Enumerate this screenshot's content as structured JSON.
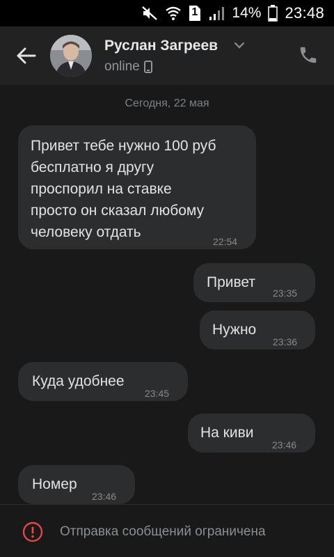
{
  "status_bar": {
    "battery_percent": "14%",
    "time": "23:48",
    "sim_label": "1",
    "icons": [
      "mute-icon",
      "wifi-icon",
      "sim-icon",
      "signal-icon",
      "battery-icon"
    ]
  },
  "header": {
    "contact_name": "Руслан Загреев",
    "status": "online",
    "icons": [
      "back-arrow-icon",
      "chevron-down-icon",
      "phone-device-icon",
      "call-icon"
    ]
  },
  "chat": {
    "date_separator": "Сегодня, 22 мая",
    "messages": [
      {
        "side": "in",
        "text": "Привет тебе нужно 100 руб\nбесплатно я другу\nпроспорил на ставке\nпросто он сказал любому\nчеловеку отдать",
        "time": "22:54"
      },
      {
        "side": "out",
        "text": "Привет",
        "time": "23:35"
      },
      {
        "side": "out",
        "text": "Нужно",
        "time": "23:36"
      },
      {
        "side": "in",
        "text": "Куда удобнее",
        "time": "23:45"
      },
      {
        "side": "out",
        "text": "На киви",
        "time": "23:46"
      },
      {
        "side": "in",
        "text": "Номер",
        "time": "23:46"
      }
    ]
  },
  "footer": {
    "notice": "Отправка сообщений ограничена",
    "icon": "warning-icon",
    "warning_color": "#e64646"
  }
}
